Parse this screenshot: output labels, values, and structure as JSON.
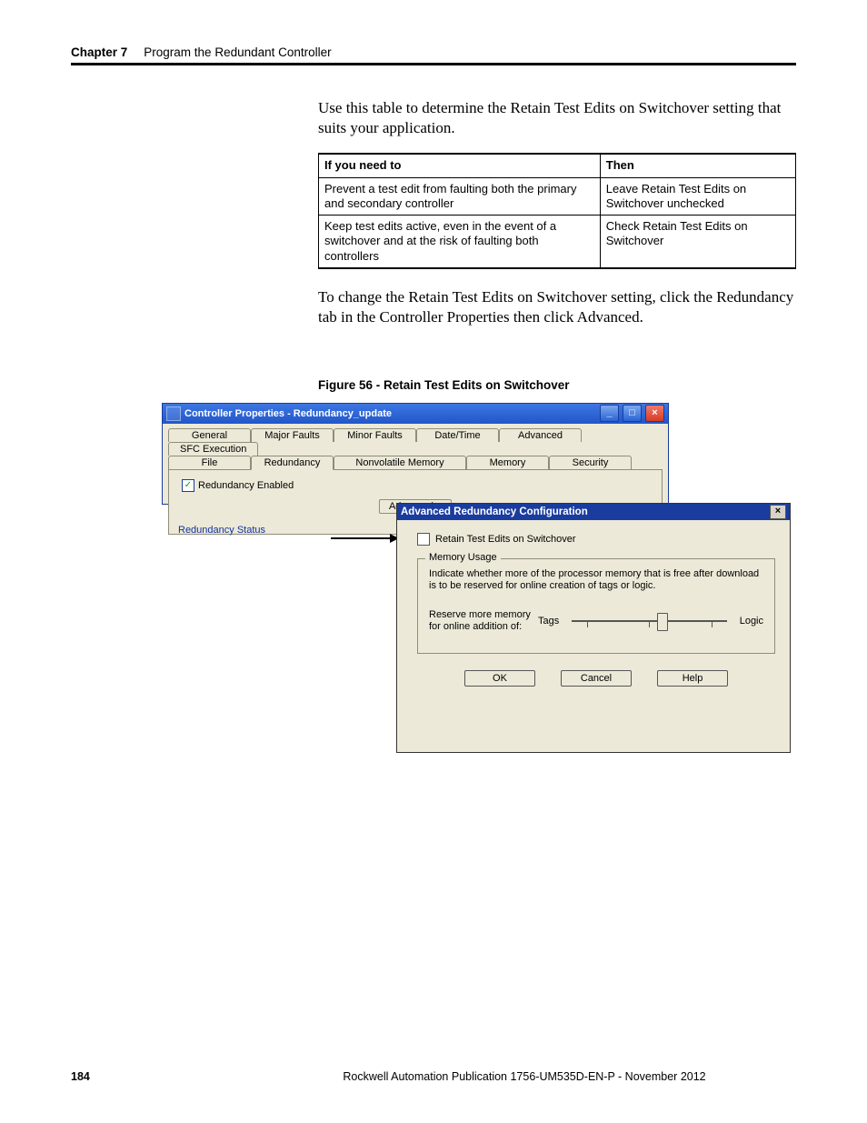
{
  "header": {
    "chapter": "Chapter 7",
    "title": "Program the Redundant Controller"
  },
  "paragraphs": {
    "p1": "Use this table to determine the Retain Test Edits on Switchover setting that suits your application.",
    "p2": "To change the Retain Test Edits on Switchover setting, click the Redundancy tab in the Controller Properties then click Advanced."
  },
  "table": {
    "h1": "If you need to",
    "h2": "Then",
    "rows": [
      {
        "c1": "Prevent a test edit from faulting both the primary and secondary controller",
        "c2": "Leave Retain Test Edits on Switchover unchecked"
      },
      {
        "c1": "Keep test edits active, even in the event of a switchover and at the risk of faulting both controllers",
        "c2": "Check Retain Test Edits on Switchover"
      }
    ]
  },
  "figure_caption": "Figure 56 - Retain Test Edits on Switchover",
  "win1": {
    "title": "Controller Properties - Redundancy_update",
    "min": "_",
    "max": "□",
    "close": "×",
    "tabs_row1": [
      "General",
      "Major Faults",
      "Minor Faults",
      "Date/Time",
      "Advanced",
      "SFC Execution"
    ],
    "tabs_row2": [
      "File",
      "Redundancy",
      "Nonvolatile Memory",
      "Memory",
      "Security"
    ],
    "active_tab_index": 1,
    "chk_label": "Redundancy Enabled",
    "adv_button": "Advanced...",
    "cutoff": "Redundancy Status"
  },
  "win2": {
    "title": "Advanced Redundancy Configuration",
    "close": "×",
    "retain_label": "Retain Test Edits on Switchover",
    "group_legend": "Memory Usage",
    "group_desc": "Indicate whether more of the processor memory that is free after download is to be reserved for online creation of tags or logic.",
    "slider_label": "Reserve more memory for online addition of:",
    "slider_left": "Tags",
    "slider_right": "Logic",
    "ok": "OK",
    "cancel": "Cancel",
    "help": "Help"
  },
  "footer": {
    "page": "184",
    "pub": "Rockwell Automation Publication 1756-UM535D-EN-P - November 2012"
  },
  "chart_data": null
}
